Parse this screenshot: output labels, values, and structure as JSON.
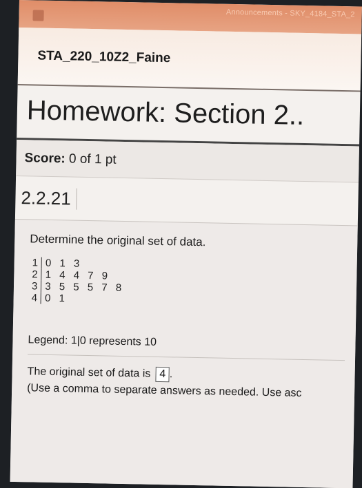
{
  "topbar": {
    "tab_title": "Announcements - SKY_4184_STA_2",
    "icon": "app-icon"
  },
  "course": {
    "title": "STA_220_10Z2_Faine"
  },
  "homework": {
    "title": "Homework: Section 2.."
  },
  "score": {
    "label": "Score:",
    "value": "0 of 1 pt"
  },
  "question": {
    "number": "2.2.21",
    "prompt": "Determine the original set of data.",
    "stem_leaf": [
      {
        "stem": "1",
        "leaves": "0 1 3"
      },
      {
        "stem": "2",
        "leaves": "1 4 4 7 9"
      },
      {
        "stem": "3",
        "leaves": "3 5 5 5 7 8"
      },
      {
        "stem": "4",
        "leaves": "0 1"
      }
    ],
    "legend": "Legend: 1|0 represents 10",
    "answer_prefix": "The original set of data is",
    "answer_value": "4",
    "answer_suffix": ".",
    "hint": "(Use a comma to separate answers as needed. Use asc"
  }
}
